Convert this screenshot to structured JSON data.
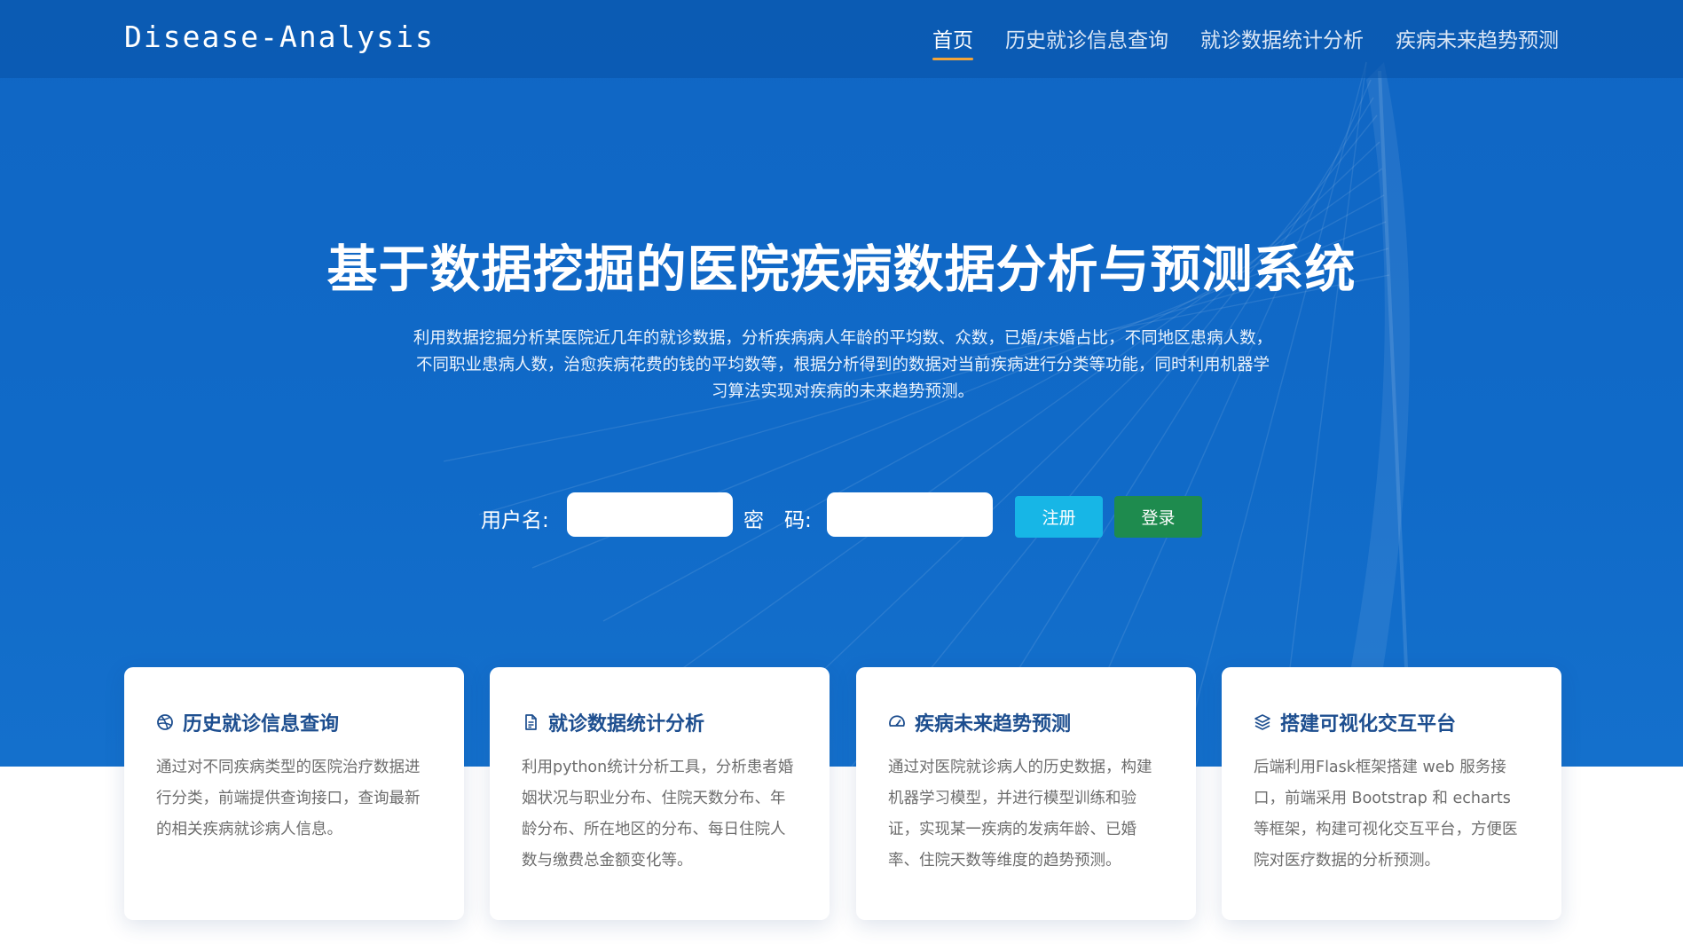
{
  "brand": "Disease-Analysis",
  "nav": {
    "items": [
      {
        "label": "首页",
        "active": true
      },
      {
        "label": "历史就诊信息查询"
      },
      {
        "label": "就诊数据统计分析"
      },
      {
        "label": "疾病未来趋势预测"
      }
    ]
  },
  "hero": {
    "title": "基于数据挖掘的医院疾病数据分析与预测系统",
    "description": "利用数据挖掘分析某医院近几年的就诊数据，分析疾病病人年龄的平均数、众数，已婚/未婚占比，不同地区患病人数，不同职业患病人数，治愈疾病花费的钱的平均数等，根据分析得到的数据对当前疾病进行分类等功能，同时利用机器学习算法实现对疾病的未来趋势预测。"
  },
  "login": {
    "username_label": "用户名:",
    "password_label": "密　码:",
    "username_value": "",
    "password_value": "",
    "register_label": "注册",
    "login_label": "登录"
  },
  "cards": [
    {
      "icon": "dribbble-icon",
      "title": "历史就诊信息查询",
      "text": "通过对不同疾病类型的医院治疗数据进行分类，前端提供查询接口，查询最新的相关疾病就诊病人信息。"
    },
    {
      "icon": "document-icon",
      "title": "就诊数据统计分析",
      "text": "利用python统计分析工具，分析患者婚姻状况与职业分布、住院天数分布、年龄分布、所在地区的分布、每日住院人数与缴费总金额变化等。"
    },
    {
      "icon": "speedometer-icon",
      "title": "疾病未来趋势预测",
      "text": "通过对医院就诊病人的历史数据，构建机器学习模型，并进行模型训练和验证，实现某一疾病的发病年龄、已婚率、住院天数等维度的趋势预测。"
    },
    {
      "icon": "layers-icon",
      "title": "搭建可视化交互平台",
      "text": "后端利用Flask框架搭建 web 服务接口，前端采用 Bootstrap 和 echarts 等框架，构建可视化交互平台，方便医院对医疗数据的分析预测。"
    }
  ],
  "colors": {
    "hero_bg": "#1066c4",
    "nav_active_underline": "#f2a43a",
    "register_button": "#17b6e6",
    "login_button": "#1e8b4e",
    "card_title": "#1d4e8f"
  }
}
